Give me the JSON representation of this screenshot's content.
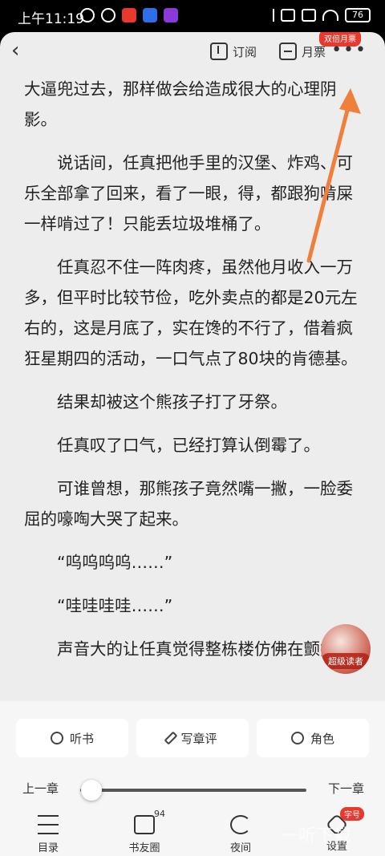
{
  "status_bar": {
    "time": "上午11:19",
    "battery": "76"
  },
  "topbar": {
    "subscribe_label": "订阅",
    "monthly_ticket_label": "月票",
    "double_ticket_badge": "双倍月票"
  },
  "content": {
    "paragraphs": [
      "大逼兜过去，那样做会给造成很大的心理阴影。",
      "说话间，任真把他手里的汉堡、炸鸡、可乐全部拿了回来，看了一眼，得，都跟狗啃屎一样啃过了！只能丢垃圾堆桶了。",
      "任真忍不住一阵肉疼，虽然他月收入一万多，但平时比较节俭，吃外卖点的都是20元左右的，这是月底了，实在馋的不行了，借着疯狂星期四的活动，一口气点了80块的肯德基。",
      "结果却被这个熊孩子打了牙祭。",
      "任真叹了口气，已经打算认倒霉了。",
      "可谁曾想，那熊孩子竟然嘴一撇，一脸委屈的嚎啕大哭了起来。",
      "“呜呜呜呜……”",
      "“哇哇哇哇……”",
      "声音大的让任真觉得整栋楼仿佛在颤抖。"
    ]
  },
  "super_reader": {
    "label": "超级读者"
  },
  "actions": {
    "listen": "听书",
    "write_review": "写章评",
    "character": "角色"
  },
  "chapter_nav": {
    "prev": "上一章",
    "next": "下一章",
    "progress": 0.05
  },
  "bottom_nav": {
    "items": [
      {
        "label": "目录",
        "icon": "list-icon"
      },
      {
        "label": "书友圈",
        "icon": "chat-icon",
        "count": "94"
      },
      {
        "label": "夜间",
        "icon": "moon-icon"
      },
      {
        "label": "设置",
        "icon": "settings-icon",
        "tag": "字号"
      }
    ]
  },
  "watermark": "一听下载"
}
